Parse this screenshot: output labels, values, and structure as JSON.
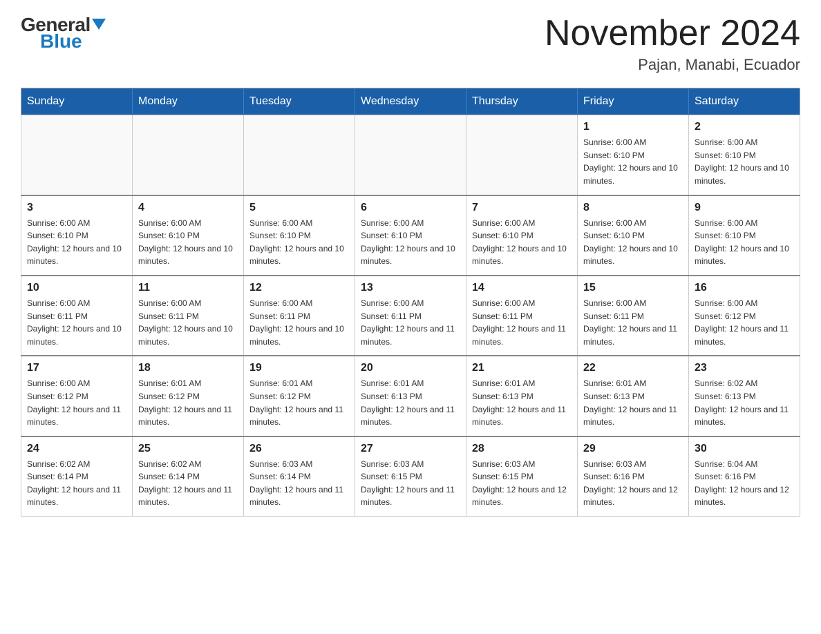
{
  "header": {
    "logo_general": "General",
    "logo_blue": "Blue",
    "month_title": "November 2024",
    "location": "Pajan, Manabi, Ecuador"
  },
  "days_of_week": [
    "Sunday",
    "Monday",
    "Tuesday",
    "Wednesday",
    "Thursday",
    "Friday",
    "Saturday"
  ],
  "weeks": [
    [
      {
        "day": "",
        "sunrise": "",
        "sunset": "",
        "daylight": "",
        "empty": true
      },
      {
        "day": "",
        "sunrise": "",
        "sunset": "",
        "daylight": "",
        "empty": true
      },
      {
        "day": "",
        "sunrise": "",
        "sunset": "",
        "daylight": "",
        "empty": true
      },
      {
        "day": "",
        "sunrise": "",
        "sunset": "",
        "daylight": "",
        "empty": true
      },
      {
        "day": "",
        "sunrise": "",
        "sunset": "",
        "daylight": "",
        "empty": true
      },
      {
        "day": "1",
        "sunrise": "Sunrise: 6:00 AM",
        "sunset": "Sunset: 6:10 PM",
        "daylight": "Daylight: 12 hours and 10 minutes.",
        "empty": false
      },
      {
        "day": "2",
        "sunrise": "Sunrise: 6:00 AM",
        "sunset": "Sunset: 6:10 PM",
        "daylight": "Daylight: 12 hours and 10 minutes.",
        "empty": false
      }
    ],
    [
      {
        "day": "3",
        "sunrise": "Sunrise: 6:00 AM",
        "sunset": "Sunset: 6:10 PM",
        "daylight": "Daylight: 12 hours and 10 minutes.",
        "empty": false
      },
      {
        "day": "4",
        "sunrise": "Sunrise: 6:00 AM",
        "sunset": "Sunset: 6:10 PM",
        "daylight": "Daylight: 12 hours and 10 minutes.",
        "empty": false
      },
      {
        "day": "5",
        "sunrise": "Sunrise: 6:00 AM",
        "sunset": "Sunset: 6:10 PM",
        "daylight": "Daylight: 12 hours and 10 minutes.",
        "empty": false
      },
      {
        "day": "6",
        "sunrise": "Sunrise: 6:00 AM",
        "sunset": "Sunset: 6:10 PM",
        "daylight": "Daylight: 12 hours and 10 minutes.",
        "empty": false
      },
      {
        "day": "7",
        "sunrise": "Sunrise: 6:00 AM",
        "sunset": "Sunset: 6:10 PM",
        "daylight": "Daylight: 12 hours and 10 minutes.",
        "empty": false
      },
      {
        "day": "8",
        "sunrise": "Sunrise: 6:00 AM",
        "sunset": "Sunset: 6:10 PM",
        "daylight": "Daylight: 12 hours and 10 minutes.",
        "empty": false
      },
      {
        "day": "9",
        "sunrise": "Sunrise: 6:00 AM",
        "sunset": "Sunset: 6:10 PM",
        "daylight": "Daylight: 12 hours and 10 minutes.",
        "empty": false
      }
    ],
    [
      {
        "day": "10",
        "sunrise": "Sunrise: 6:00 AM",
        "sunset": "Sunset: 6:11 PM",
        "daylight": "Daylight: 12 hours and 10 minutes.",
        "empty": false
      },
      {
        "day": "11",
        "sunrise": "Sunrise: 6:00 AM",
        "sunset": "Sunset: 6:11 PM",
        "daylight": "Daylight: 12 hours and 10 minutes.",
        "empty": false
      },
      {
        "day": "12",
        "sunrise": "Sunrise: 6:00 AM",
        "sunset": "Sunset: 6:11 PM",
        "daylight": "Daylight: 12 hours and 10 minutes.",
        "empty": false
      },
      {
        "day": "13",
        "sunrise": "Sunrise: 6:00 AM",
        "sunset": "Sunset: 6:11 PM",
        "daylight": "Daylight: 12 hours and 11 minutes.",
        "empty": false
      },
      {
        "day": "14",
        "sunrise": "Sunrise: 6:00 AM",
        "sunset": "Sunset: 6:11 PM",
        "daylight": "Daylight: 12 hours and 11 minutes.",
        "empty": false
      },
      {
        "day": "15",
        "sunrise": "Sunrise: 6:00 AM",
        "sunset": "Sunset: 6:11 PM",
        "daylight": "Daylight: 12 hours and 11 minutes.",
        "empty": false
      },
      {
        "day": "16",
        "sunrise": "Sunrise: 6:00 AM",
        "sunset": "Sunset: 6:12 PM",
        "daylight": "Daylight: 12 hours and 11 minutes.",
        "empty": false
      }
    ],
    [
      {
        "day": "17",
        "sunrise": "Sunrise: 6:00 AM",
        "sunset": "Sunset: 6:12 PM",
        "daylight": "Daylight: 12 hours and 11 minutes.",
        "empty": false
      },
      {
        "day": "18",
        "sunrise": "Sunrise: 6:01 AM",
        "sunset": "Sunset: 6:12 PM",
        "daylight": "Daylight: 12 hours and 11 minutes.",
        "empty": false
      },
      {
        "day": "19",
        "sunrise": "Sunrise: 6:01 AM",
        "sunset": "Sunset: 6:12 PM",
        "daylight": "Daylight: 12 hours and 11 minutes.",
        "empty": false
      },
      {
        "day": "20",
        "sunrise": "Sunrise: 6:01 AM",
        "sunset": "Sunset: 6:13 PM",
        "daylight": "Daylight: 12 hours and 11 minutes.",
        "empty": false
      },
      {
        "day": "21",
        "sunrise": "Sunrise: 6:01 AM",
        "sunset": "Sunset: 6:13 PM",
        "daylight": "Daylight: 12 hours and 11 minutes.",
        "empty": false
      },
      {
        "day": "22",
        "sunrise": "Sunrise: 6:01 AM",
        "sunset": "Sunset: 6:13 PM",
        "daylight": "Daylight: 12 hours and 11 minutes.",
        "empty": false
      },
      {
        "day": "23",
        "sunrise": "Sunrise: 6:02 AM",
        "sunset": "Sunset: 6:13 PM",
        "daylight": "Daylight: 12 hours and 11 minutes.",
        "empty": false
      }
    ],
    [
      {
        "day": "24",
        "sunrise": "Sunrise: 6:02 AM",
        "sunset": "Sunset: 6:14 PM",
        "daylight": "Daylight: 12 hours and 11 minutes.",
        "empty": false
      },
      {
        "day": "25",
        "sunrise": "Sunrise: 6:02 AM",
        "sunset": "Sunset: 6:14 PM",
        "daylight": "Daylight: 12 hours and 11 minutes.",
        "empty": false
      },
      {
        "day": "26",
        "sunrise": "Sunrise: 6:03 AM",
        "sunset": "Sunset: 6:14 PM",
        "daylight": "Daylight: 12 hours and 11 minutes.",
        "empty": false
      },
      {
        "day": "27",
        "sunrise": "Sunrise: 6:03 AM",
        "sunset": "Sunset: 6:15 PM",
        "daylight": "Daylight: 12 hours and 11 minutes.",
        "empty": false
      },
      {
        "day": "28",
        "sunrise": "Sunrise: 6:03 AM",
        "sunset": "Sunset: 6:15 PM",
        "daylight": "Daylight: 12 hours and 12 minutes.",
        "empty": false
      },
      {
        "day": "29",
        "sunrise": "Sunrise: 6:03 AM",
        "sunset": "Sunset: 6:16 PM",
        "daylight": "Daylight: 12 hours and 12 minutes.",
        "empty": false
      },
      {
        "day": "30",
        "sunrise": "Sunrise: 6:04 AM",
        "sunset": "Sunset: 6:16 PM",
        "daylight": "Daylight: 12 hours and 12 minutes.",
        "empty": false
      }
    ]
  ]
}
